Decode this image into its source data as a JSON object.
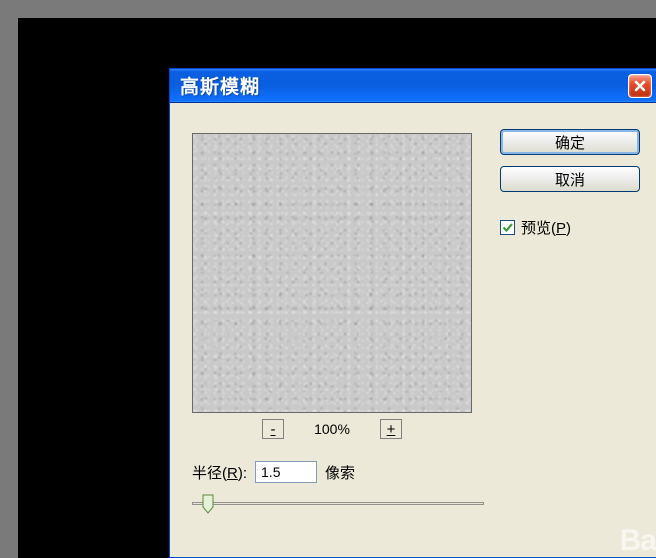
{
  "dialog": {
    "title": "高斯模糊",
    "zoom": {
      "minus": "-",
      "plus": "+",
      "level": "100%"
    },
    "buttons": {
      "ok": "确定",
      "cancel": "取消"
    },
    "preview_checkbox": {
      "checked": true,
      "label_prefix": "预览(",
      "hotkey": "P",
      "label_suffix": ")"
    },
    "radius": {
      "label_prefix": "半径(",
      "hotkey": "R",
      "label_suffix": "):",
      "value": "1.5",
      "unit": "像索"
    }
  },
  "watermark": "Ba"
}
